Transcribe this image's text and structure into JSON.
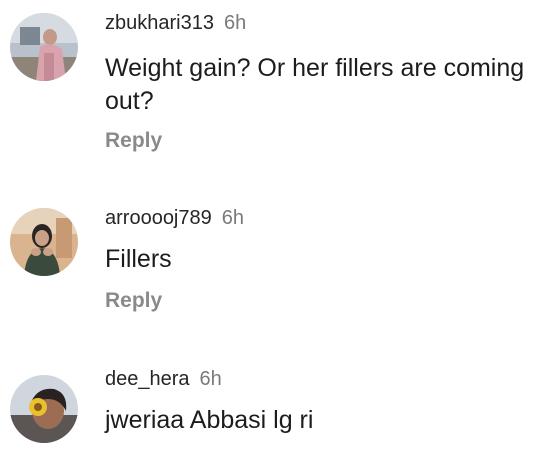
{
  "comments": [
    {
      "username": "zbukhari313",
      "time": "6h",
      "text_line1": "Weight gain? Or her fillers are coming",
      "text_line2": "out?",
      "reply_label": "Reply"
    },
    {
      "username": "arrooooj789",
      "time": "6h",
      "text": "Fillers",
      "reply_label": "Reply"
    },
    {
      "username": "dee_hera",
      "time": "6h",
      "text": "jweriaa Abbasi lg ri"
    }
  ]
}
